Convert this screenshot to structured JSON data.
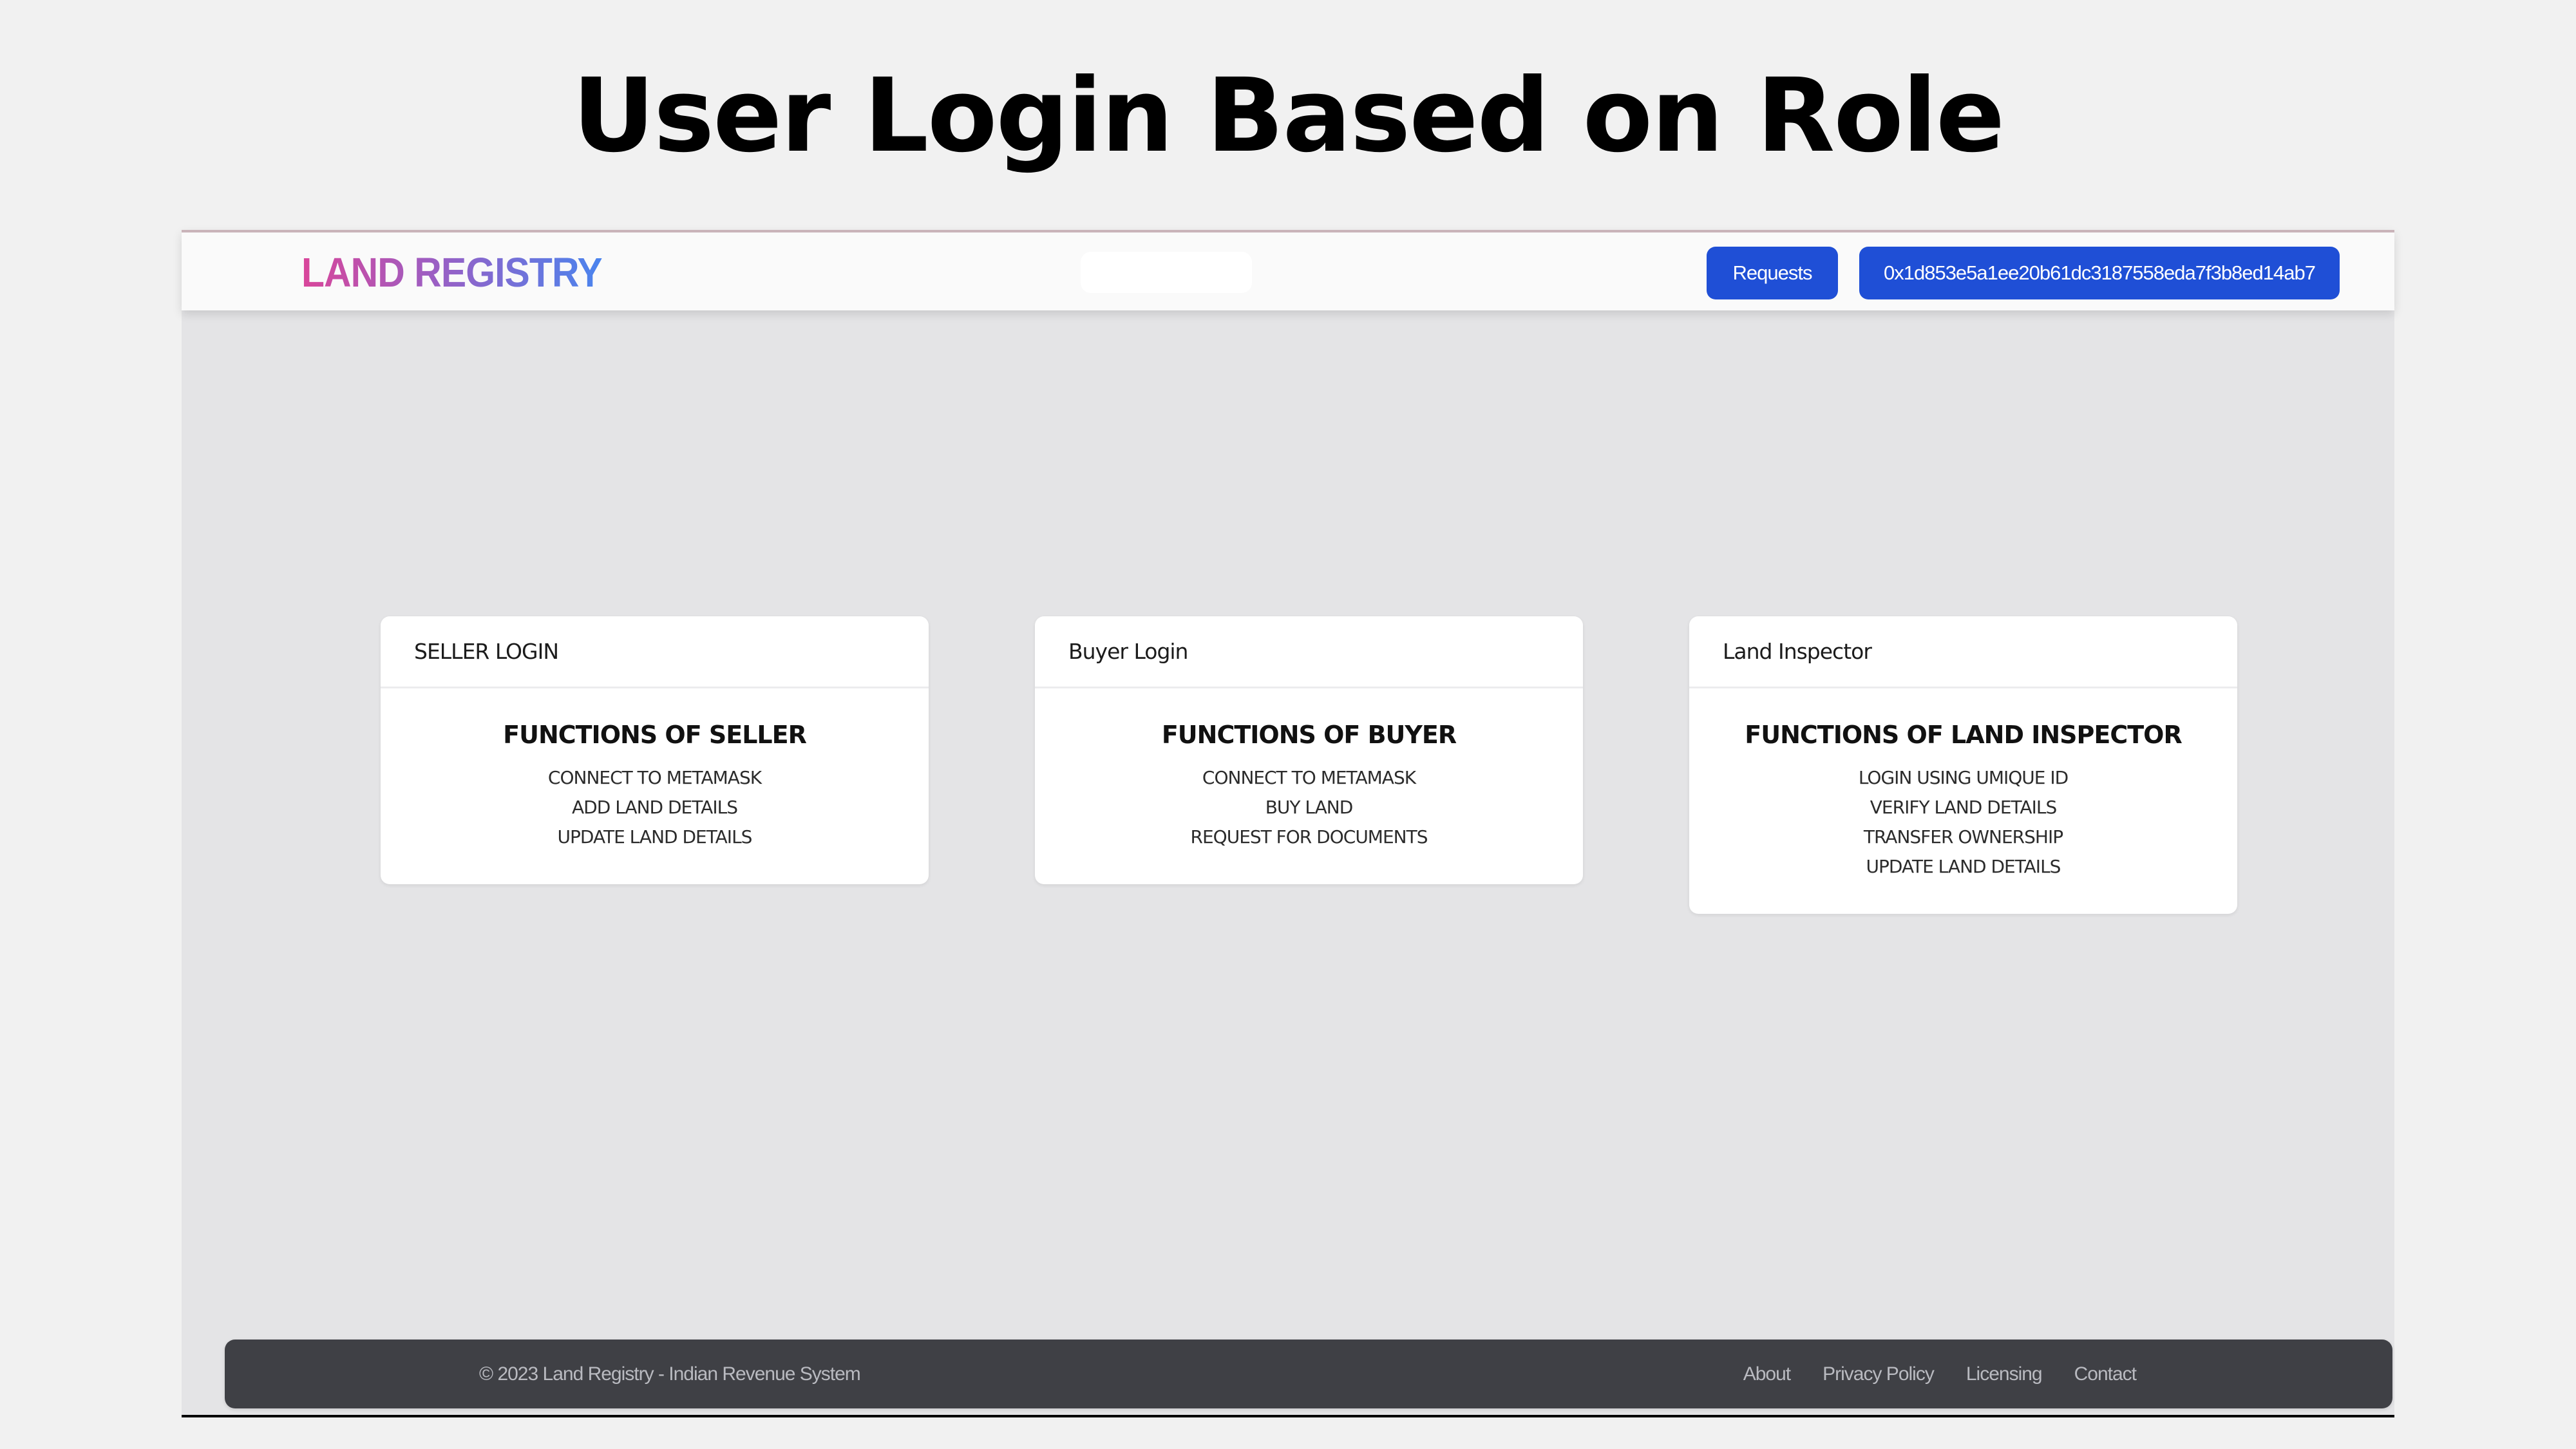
{
  "slide": {
    "title": "User Login Based on Role"
  },
  "header": {
    "brand": "LAND REGISTRY",
    "requests_label": "Requests",
    "account_address": "0x1d853e5a1ee20b61dc3187558eda7f3b8ed14ab7"
  },
  "cards": [
    {
      "header": "SELLER LOGIN",
      "heading": "FUNCTIONS OF SELLER",
      "items": [
        "CONNECT TO METAMASK",
        "ADD LAND DETAILS",
        "UPDATE LAND DETAILS"
      ]
    },
    {
      "header": "Buyer Login",
      "heading": "FUNCTIONS OF BUYER",
      "items": [
        "CONNECT TO METAMASK",
        "BUY LAND",
        "REQUEST FOR DOCUMENTS"
      ]
    },
    {
      "header": "Land Inspector",
      "heading": "FUNCTIONS OF LAND INSPECTOR",
      "items": [
        "LOGIN USING UMIQUE ID",
        "VERIFY LAND DETAILS",
        "TRANSFER OWNERSHIP",
        "UPDATE LAND DETAILS"
      ]
    }
  ],
  "footer": {
    "copyright": "© 2023 Land Registry - Indian Revenue System",
    "links": [
      "About",
      "Privacy Policy",
      "Licensing",
      "Contact"
    ]
  },
  "colors": {
    "primary_button": "#1f4fd6",
    "brand_gradient_start": "#d9469a",
    "brand_gradient_end": "#4a84ee",
    "footer_bg": "#3f4045",
    "page_bg": "#e4e4e6"
  }
}
